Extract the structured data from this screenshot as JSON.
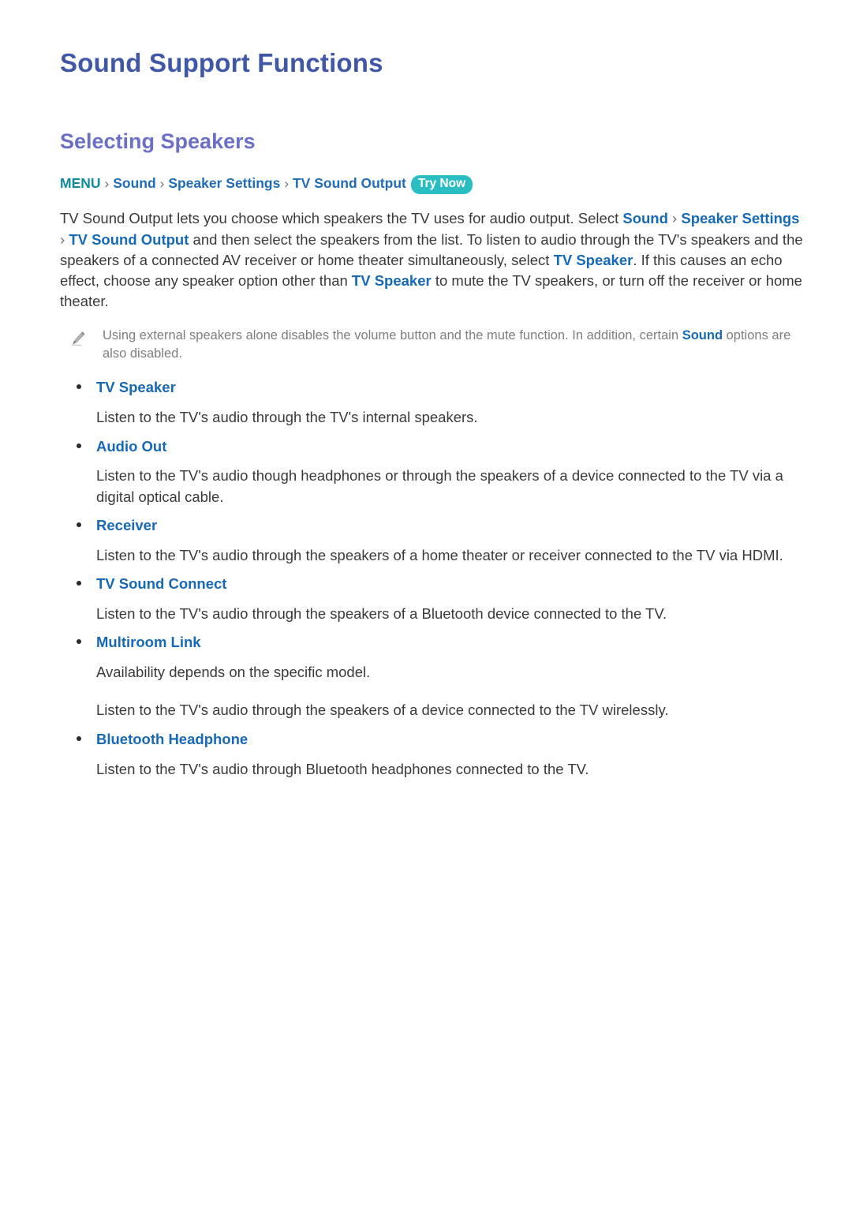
{
  "page": {
    "title": "Sound Support Functions",
    "section_title": "Selecting Speakers"
  },
  "breadcrumb": {
    "menu": "MENU",
    "separator": "›",
    "items": [
      "Sound",
      "Speaker Settings",
      "TV Sound Output"
    ],
    "badge": "Try Now"
  },
  "intro": {
    "t1": "TV Sound Output lets you choose which speakers the TV uses for audio output. Select ",
    "l1": "Sound",
    "s1": " › ",
    "l2": "Speaker Settings",
    "s2": " › ",
    "l3": "TV Sound Output",
    "t2": " and then select the speakers from the list. To listen to audio through the TV's speakers and the speakers of a connected AV receiver or home theater simultaneously, select ",
    "l4": "TV Speaker",
    "t3": ". If this causes an echo effect, choose any speaker option other than ",
    "l5": "TV Speaker",
    "t4": " to mute the TV speakers, or turn off the receiver or home theater."
  },
  "note": {
    "icon": "pencil-icon",
    "text_before": "Using external speakers alone disables the volume button and the mute function. In addition, certain ",
    "link": "Sound",
    "text_after": " options are also disabled."
  },
  "options": [
    {
      "label": "TV Speaker",
      "descriptions": [
        "Listen to the TV's audio through the TV's internal speakers."
      ]
    },
    {
      "label": "Audio Out",
      "descriptions": [
        "Listen to the TV's audio though headphones or through the speakers of a device connected to the TV via a digital optical cable."
      ]
    },
    {
      "label": "Receiver",
      "descriptions": [
        "Listen to the TV's audio through the speakers of a home theater or receiver connected to the TV via HDMI."
      ]
    },
    {
      "label": "TV Sound Connect",
      "descriptions": [
        "Listen to the TV's audio through the speakers of a Bluetooth device connected to the TV."
      ]
    },
    {
      "label": "Multiroom Link",
      "descriptions": [
        "Availability depends on the specific model.",
        "Listen to the TV's audio through the speakers of a device connected to the TV wirelessly."
      ]
    },
    {
      "label": "Bluetooth Headphone",
      "descriptions": [
        "Listen to the TV's audio through Bluetooth headphones connected to the TV."
      ]
    }
  ],
  "colors": {
    "page_title": "#3f57a6",
    "section_title": "#6a70c6",
    "link_blue": "#1669b7",
    "menu_teal": "#0e8c9c",
    "badge_teal": "#2abec3",
    "body_text": "#3a3a3a",
    "note_text": "#7e7e7e",
    "background": "#ffffff"
  }
}
